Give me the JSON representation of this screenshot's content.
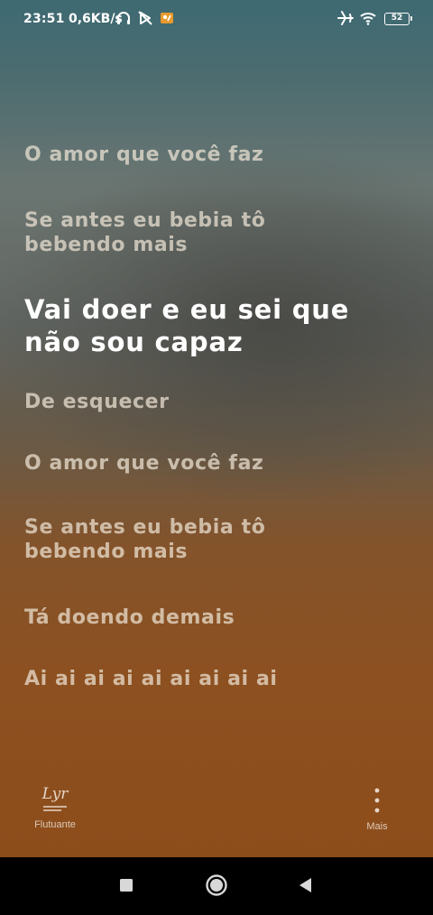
{
  "status_bar": {
    "time": "23:51",
    "network_speed": "0,6KB/s",
    "battery_level": "52",
    "icons": [
      "headphones-icon",
      "bypass-icon",
      "app-notification-icon",
      "airplane-icon",
      "wifi-icon",
      "battery-icon"
    ]
  },
  "lyrics": {
    "lines": [
      "O amor que você faz",
      "Se antes eu bebia tô",
      "bebendo mais",
      "Vai doer e eu sei que",
      "não sou capaz",
      "De esquecer",
      "O amor que você faz",
      "Se antes eu bebia tô",
      "bebendo mais",
      "Tá doendo demais",
      "Ai ai ai ai ai ai ai ai ai"
    ],
    "active_line": "Vai doer e eu sei que não sou capaz"
  },
  "controls": {
    "floating_icon_text": "Lyr",
    "floating_label": "Flutuante",
    "more_label": "Mais"
  },
  "colors": {
    "active_text": "#ffffff",
    "inactive_text": "#eee4d6",
    "background_top": "#3e6a72",
    "background_bottom": "#8d4d1b"
  },
  "nav_bar": {
    "icons": [
      "recents-square-icon",
      "home-circle-icon",
      "back-triangle-icon"
    ]
  }
}
